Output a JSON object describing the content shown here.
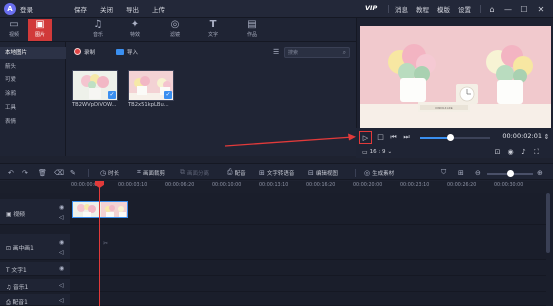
{
  "titlebar": {
    "app_name": "登录",
    "menu": [
      "保存",
      "关闭",
      "导出",
      "上传"
    ],
    "vip": "VIP",
    "links": [
      "消息",
      "教程",
      "模版",
      "设置"
    ]
  },
  "tool_tabs": [
    {
      "label": "视频",
      "icon": "video-icon"
    },
    {
      "label": "图片",
      "icon": "image-icon"
    },
    {
      "label": "音乐",
      "icon": "music-icon"
    },
    {
      "label": "特效",
      "icon": "effects-icon"
    },
    {
      "label": "滤镜",
      "icon": "filter-icon"
    },
    {
      "label": "文字",
      "icon": "text-icon"
    },
    {
      "label": "作品",
      "icon": "works-icon"
    }
  ],
  "active_tab": "图片",
  "sidebar": {
    "items": [
      "本地图片",
      "箭头",
      "可爱",
      "涂鸦",
      "工具",
      "表情"
    ],
    "active": "本地图片"
  },
  "media": {
    "record_label": "录制",
    "import_label": "导入",
    "search_placeholder": "搜索",
    "thumbs": [
      {
        "name": "TB2WVpDiVOW..."
      },
      {
        "name": "TB2x51kpLBu..."
      }
    ]
  },
  "preview": {
    "timecode": "00:00:02:01",
    "progress": 0.43,
    "ratio": "16 : 9",
    "sign_text": "KINFOLK LIFE"
  },
  "edit_toolbar": {
    "items": [
      {
        "label": "时长",
        "icon": "clock-icon",
        "enabled": true
      },
      {
        "label": "画面裁剪",
        "icon": "crop-icon",
        "enabled": true
      },
      {
        "label": "画面分离",
        "icon": "split-icon",
        "enabled": false
      },
      {
        "label": "配音",
        "icon": "mic-icon",
        "enabled": true
      },
      {
        "label": "文字转语音",
        "icon": "tts-icon",
        "enabled": true
      },
      {
        "label": "编辑视图",
        "icon": "view-icon",
        "enabled": true
      },
      {
        "label": "生成素材",
        "icon": "generate-icon",
        "enabled": true
      }
    ]
  },
  "ruler": {
    "ticks": [
      "00:00:00:00",
      "00:00:03:10",
      "00:00:06:20",
      "00:00:10:00",
      "00:00:13:10",
      "00:00:16:20",
      "00:00:20:00",
      "00:00:23:10",
      "00:00:26:20",
      "00:00:30:00"
    ]
  },
  "tracks": [
    {
      "label": "视频"
    },
    {
      "label": "画中画1"
    },
    {
      "label": "文字1"
    },
    {
      "label": "音乐1"
    },
    {
      "label": "配音1"
    }
  ],
  "colors": {
    "accent_red": "#d13a3a",
    "accent_blue": "#3a8ff0",
    "background": "#1e2230"
  }
}
